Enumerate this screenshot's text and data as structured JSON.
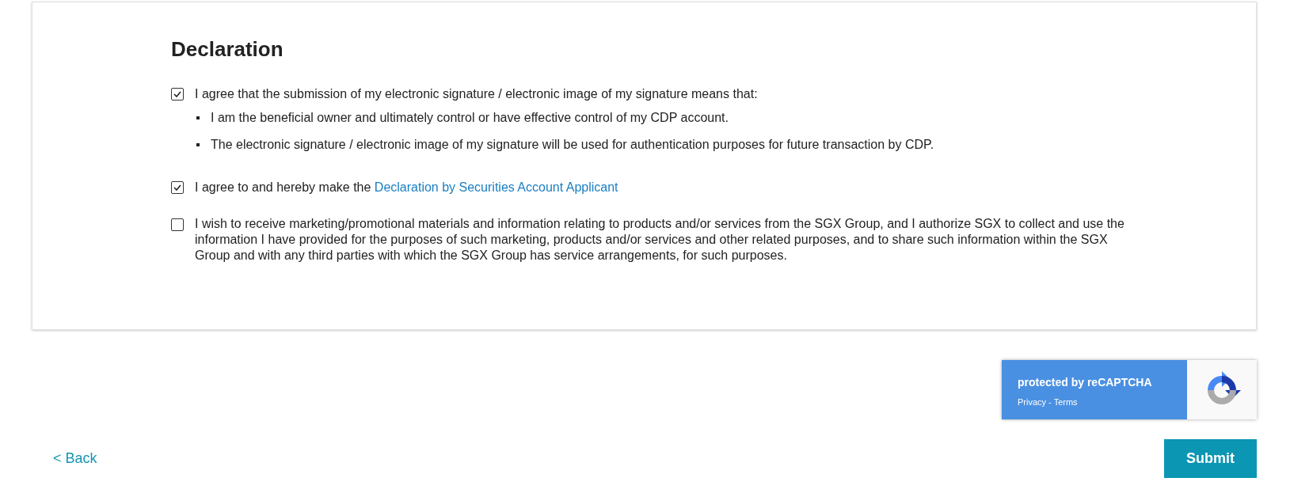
{
  "declaration": {
    "title": "Declaration",
    "items": [
      {
        "checked": true,
        "text": "I agree that the submission of my electronic signature / electronic image of my signature means that:",
        "bullets": [
          "I am the beneficial owner and ultimately control or have effective control of my CDP account.",
          "The electronic signature / electronic image of my signature will be used for authentication purposes for future transaction by CDP."
        ]
      },
      {
        "checked": true,
        "text": "I agree to and hereby make the",
        "link": "Declaration by Securities Account Applicant"
      },
      {
        "checked": false,
        "text": "I wish to receive marketing/promotional materials and information relating to products and/or services from the SGX Group, and I authorize SGX to collect and use the information I have provided for the purposes of such marketing, products and/or services and other related purposes, and to share such information within the SGX Group and with any third parties with which the SGX Group has service arrangements, for such purposes."
      }
    ]
  },
  "recaptcha": {
    "title": "protected by reCAPTCHA",
    "links": "Privacy - Terms"
  },
  "back": "< Back",
  "submit": "Submit"
}
